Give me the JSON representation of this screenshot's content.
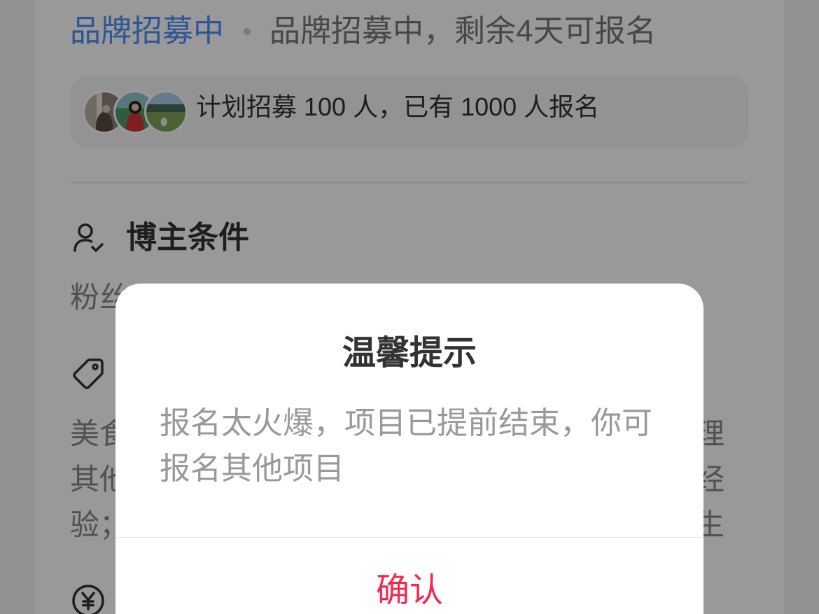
{
  "status": {
    "badge": "品牌招募中",
    "text": "品牌招募中，剩余4天可报名"
  },
  "recruit": {
    "summary": "计划招募 100 人，已有 1000 人报名"
  },
  "sections": [
    {
      "icon": "user-check-icon",
      "title": "博主条件",
      "lines": [
        "粉丝"
      ]
    },
    {
      "icon": "tag-icon",
      "lines_left": [
        "美食",
        "其他",
        "验；"
      ],
      "lines_right": [
        "理",
        "经",
        "生"
      ]
    },
    {
      "icon": "yen-icon"
    }
  ],
  "modal": {
    "title": "温馨提示",
    "message": "报名太火爆，项目已提前结束，你可报名其他项目",
    "confirm_label": "确认"
  },
  "colors": {
    "brand_blue": "#4d8ff7",
    "confirm_red": "#f2294e",
    "mask": "rgba(0,0,0,0.4)",
    "text_primary": "#333333",
    "text_secondary": "#999999"
  }
}
